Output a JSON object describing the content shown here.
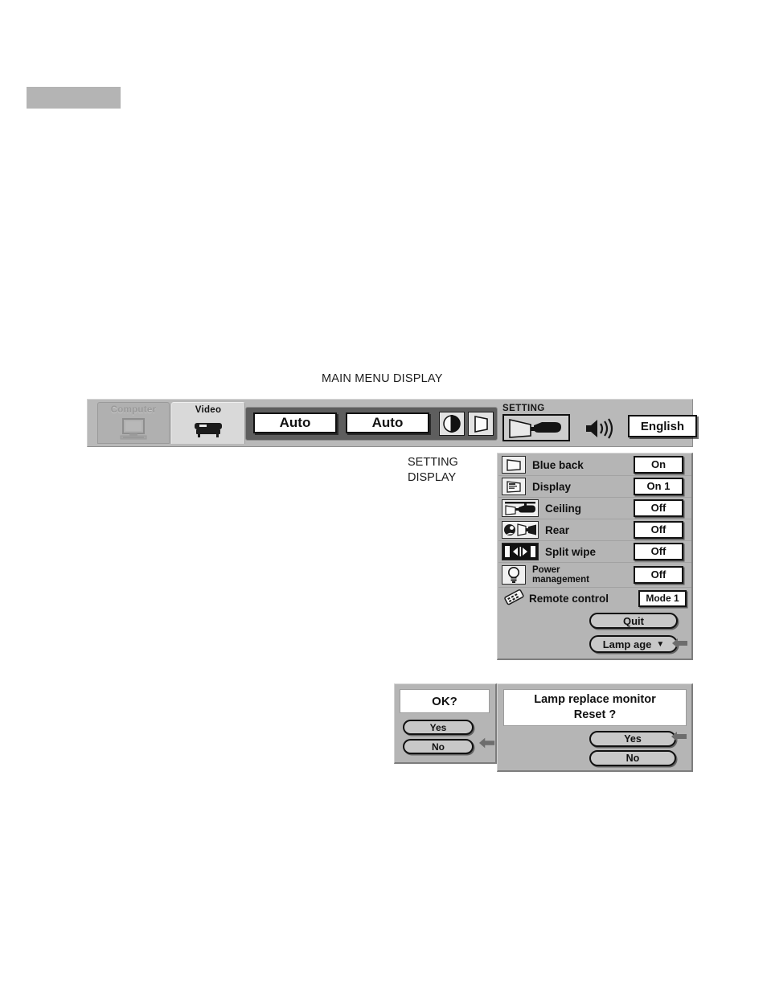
{
  "page": {
    "gray_block": "",
    "main_menu_caption": "MAIN MENU DISPLAY",
    "setting_display_caption_line1": "SETTING",
    "setting_display_caption_line2": "DISPLAY"
  },
  "menu_bar": {
    "tabs": [
      {
        "label": "Computer",
        "icon": "monitor-icon",
        "active": false
      },
      {
        "label": "Video",
        "icon": "video-deck-icon",
        "active": true
      }
    ],
    "auto_buttons": [
      {
        "label": "Auto"
      },
      {
        "label": "Auto"
      }
    ],
    "icons": [
      {
        "name": "contrast-icon"
      },
      {
        "name": "keystone-icon"
      }
    ],
    "setting_group_label": "SETTING",
    "setting_icon": "projector-screen-icon",
    "speaker_icon": "speaker-volume-icon",
    "language_button": "English"
  },
  "setting_panel": {
    "rows": [
      {
        "label": "Blue back",
        "value": "On",
        "icon": "blank-screen-icon"
      },
      {
        "label": "Display",
        "value": "On 1",
        "icon": "on-screen-display-icon"
      },
      {
        "label": "Ceiling",
        "value": "Off",
        "icon": "ceiling-mount-icon"
      },
      {
        "label": "Rear",
        "value": "Off",
        "icon": "rear-projection-icon"
      },
      {
        "label": "Split wipe",
        "value": "Off",
        "icon": "split-wipe-icon"
      },
      {
        "label": "Power\nmanagement",
        "value": "Off",
        "icon": "lamp-bulb-icon"
      },
      {
        "label": "Remote control",
        "value": "Mode 1",
        "icon": "remote-control-icon"
      }
    ],
    "row_labels": {
      "blue_back": "Blue back",
      "display": "Display",
      "ceiling": "Ceiling",
      "rear": "Rear",
      "split_wipe": "Split wipe",
      "power_management_line1": "Power",
      "power_management_line2": "management",
      "remote_control": "Remote control"
    },
    "row_values": {
      "blue_back": "On",
      "display": "On 1",
      "ceiling": "Off",
      "rear": "Off",
      "split_wipe": "Off",
      "power_management": "Off",
      "remote_control": "Mode 1"
    },
    "quit_button": "Quit",
    "lamp_age_button": "Lamp age",
    "lamp_age_caret": "▼"
  },
  "ok_dialog": {
    "title": "OK?",
    "yes_button": "Yes",
    "no_button": "No"
  },
  "lamp_dialog": {
    "title_line1": "Lamp replace monitor",
    "title_line2": "Reset ?",
    "yes_button": "Yes",
    "no_button": "No"
  },
  "colors": {
    "panel_gray": "#b5b5b5",
    "menu_gray": "#b9b9b9",
    "tab_active": "#d9d9d9",
    "tab_inactive": "#b0b0b0",
    "strip_dark": "#5e5e5e",
    "value_white": "#ffffff",
    "outline_black": "#111111",
    "header_block": "#b4b4b4"
  }
}
